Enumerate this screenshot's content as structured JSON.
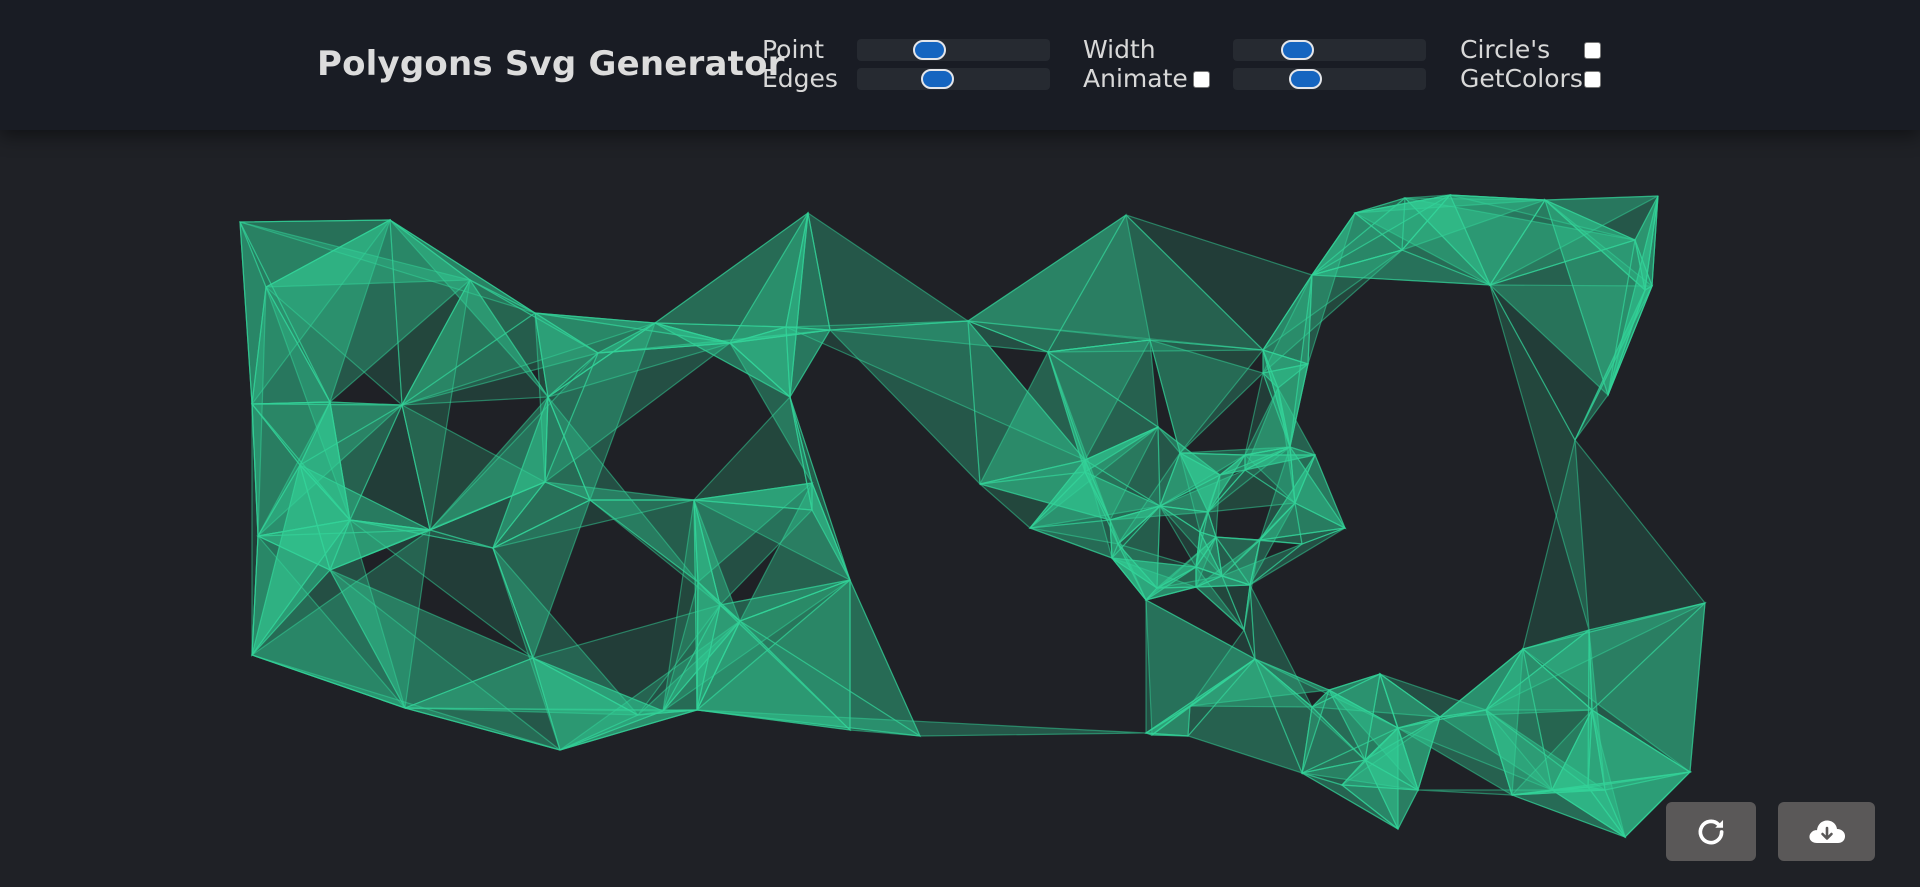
{
  "app": {
    "title": "Polygons Svg Generator"
  },
  "controls": {
    "point_label": "Point",
    "edges_label": "Edges",
    "width_label": "Width",
    "animate_label": "Animate",
    "circles_label": "Circle's",
    "getcolors_label": "GetColors",
    "point_value": 0.35,
    "edges_value": 0.4,
    "width_value": 0.3,
    "width2_value": 0.35,
    "animate_checked": false,
    "circles_checked": false,
    "getcolors_checked": false
  },
  "colors": {
    "accent": "#1565c0",
    "polygon_fill": "#34d399",
    "background": "#1f2126",
    "header": "#191c24",
    "button": "#5a5858"
  },
  "icons": {
    "refresh": "refresh-icon",
    "download": "cloud-download-icon"
  }
}
